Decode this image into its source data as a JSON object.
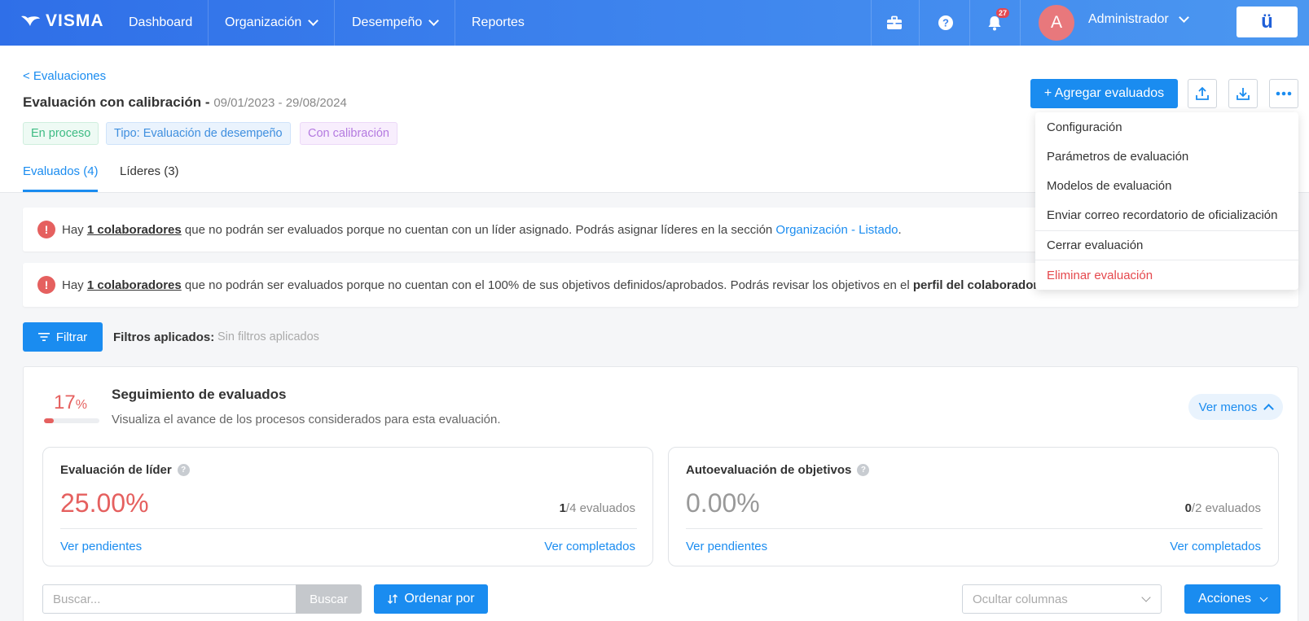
{
  "navbar": {
    "logo": "VISMA",
    "items": [
      {
        "label": "Dashboard"
      },
      {
        "label": "Organización"
      },
      {
        "label": "Desempeño"
      },
      {
        "label": "Reportes"
      }
    ],
    "notifications_count": "27",
    "avatar_initial": "A",
    "user_name": "Administrador",
    "brand_glyph": "ü"
  },
  "header": {
    "back_link": "< Evaluaciones",
    "title": "Evaluación con calibración -",
    "dates": "09/01/2023 - 29/08/2024",
    "tags": {
      "status": "En proceso",
      "type": "Tipo: Evaluación de desempeño",
      "calibration": "Con calibración"
    },
    "tabs": [
      {
        "label": "Evaluados (4)"
      },
      {
        "label": "Líderes (3)"
      }
    ],
    "add_button": "+ Agregar evaluados"
  },
  "dropdown_menu": {
    "items": [
      "Configuración",
      "Parámetros de evaluación",
      "Modelos de evaluación",
      "Enviar correo recordatorio de oficialización",
      "Cerrar evaluación",
      "Eliminar evaluación"
    ]
  },
  "alerts": [
    {
      "prefix": "Hay",
      "count_link": "1 colaboradores",
      "text": "que no podrán ser evaluados porque no cuentan con un líder asignado. Podrás asignar líderes en la sección",
      "link": "Organización - Listado",
      "suffix": "."
    },
    {
      "prefix": "Hay",
      "count_link": "1 colaboradores",
      "text": "que no podrán ser evaluados porque no cuentan con el 100% de sus objetivos definidos/aprobados. Podrás revisar los objetivos en el",
      "bold": "perfil del colaborador"
    }
  ],
  "filters": {
    "button": "Filtrar",
    "label": "Filtros aplicados:",
    "value": "Sin filtros aplicados"
  },
  "tracking": {
    "percent": "17",
    "percent_unit": "%",
    "progress": 0.17,
    "title": "Seguimiento de evaluados",
    "subtitle": "Visualiza el avance de los procesos considerados para esta evaluación.",
    "toggle": "Ver menos",
    "stats": [
      {
        "title": "Evaluación de líder",
        "percent": "25.00%",
        "done": "1",
        "total": "/4 evaluados",
        "pending_link": "Ver pendientes",
        "completed_link": "Ver completados",
        "color": "#e5605f"
      },
      {
        "title": "Autoevaluación de objetivos",
        "percent": "0.00%",
        "done": "0",
        "total": "/2 evaluados",
        "pending_link": "Ver pendientes",
        "completed_link": "Ver completados",
        "color": "#999999"
      }
    ]
  },
  "toolbar": {
    "search_placeholder": "Buscar...",
    "search_button": "Buscar",
    "order_button": "Ordenar por",
    "columns_placeholder": "Ocultar columnas",
    "actions_button": "Acciones"
  }
}
